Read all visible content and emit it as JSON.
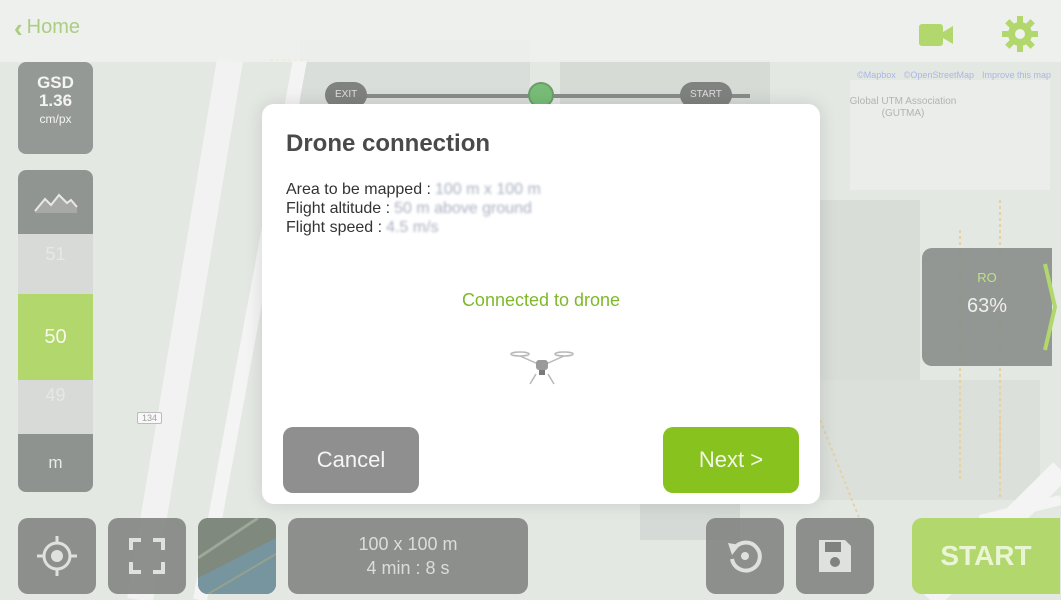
{
  "topbar": {
    "back_label": "Home",
    "back_icon": "chevron-left-icon",
    "camera_icon": "video-camera-icon",
    "settings_icon": "gear-icon",
    "accent_color": "#88c21f"
  },
  "left_panel": {
    "gsd_label": "GSD",
    "gsd_value": "1.36",
    "gsd_unit": "cm/px",
    "terrain_icon": "terrain-icon",
    "altitude_above": "51",
    "altitude_selected": "50",
    "altitude_below": "49",
    "altitude_unit": "m"
  },
  "map": {
    "attributions": [
      "©Mapbox",
      "©OpenStreetMap",
      "Improve this map"
    ],
    "poi_label": "Global UTM Association (GUTMA)",
    "road_badge": "134",
    "waypoints": [
      "EXIT",
      "START"
    ]
  },
  "signal_box": {
    "top_label": "RO",
    "battery": "63%"
  },
  "bottom_bar": {
    "locate_icon": "locate-icon",
    "fullscreen_icon": "fullscreen-icon",
    "satellite_icon": "satellite-layer-icon",
    "summary_area": "100 x 100 m",
    "summary_time": "4 min : 8 s",
    "undo_icon": "undo-icon",
    "save_icon": "save-icon",
    "start_label": "START"
  },
  "modal": {
    "title": "Drone connection",
    "rows": [
      {
        "label": "Area to be mapped :",
        "value": "100 m x 100 m"
      },
      {
        "label": "Flight altitude :",
        "value": "50 m above ground"
      },
      {
        "label": "Flight speed :",
        "value": "4.5 m/s"
      }
    ],
    "status": "Connected to drone",
    "drone_icon": "drone-icon",
    "cancel_label": "Cancel",
    "next_label": "Next >"
  }
}
